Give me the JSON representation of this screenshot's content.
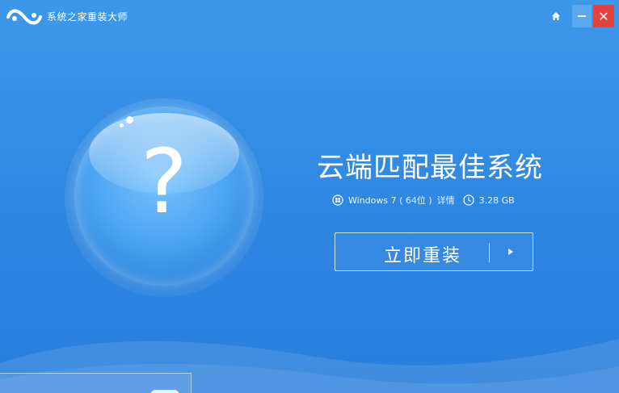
{
  "window": {
    "title": "系统之家重装大师",
    "home_icon": "home-icon",
    "minimize_icon": "minimize-icon",
    "close_icon": "close-icon",
    "close_glyph": "✕"
  },
  "main": {
    "orb_symbol": "?",
    "headline": "云端匹配最佳系统",
    "system_name": "Windows 7 ( 64位 )",
    "details_link": "详情",
    "size": "3.28 GB",
    "install_button": "立即重装"
  },
  "bottom": {
    "left_text": "",
    "right_text": ""
  },
  "colors": {
    "background": "#2f86e1",
    "close_button": "#e3433f",
    "minimize_button": "#5aa9f0"
  }
}
